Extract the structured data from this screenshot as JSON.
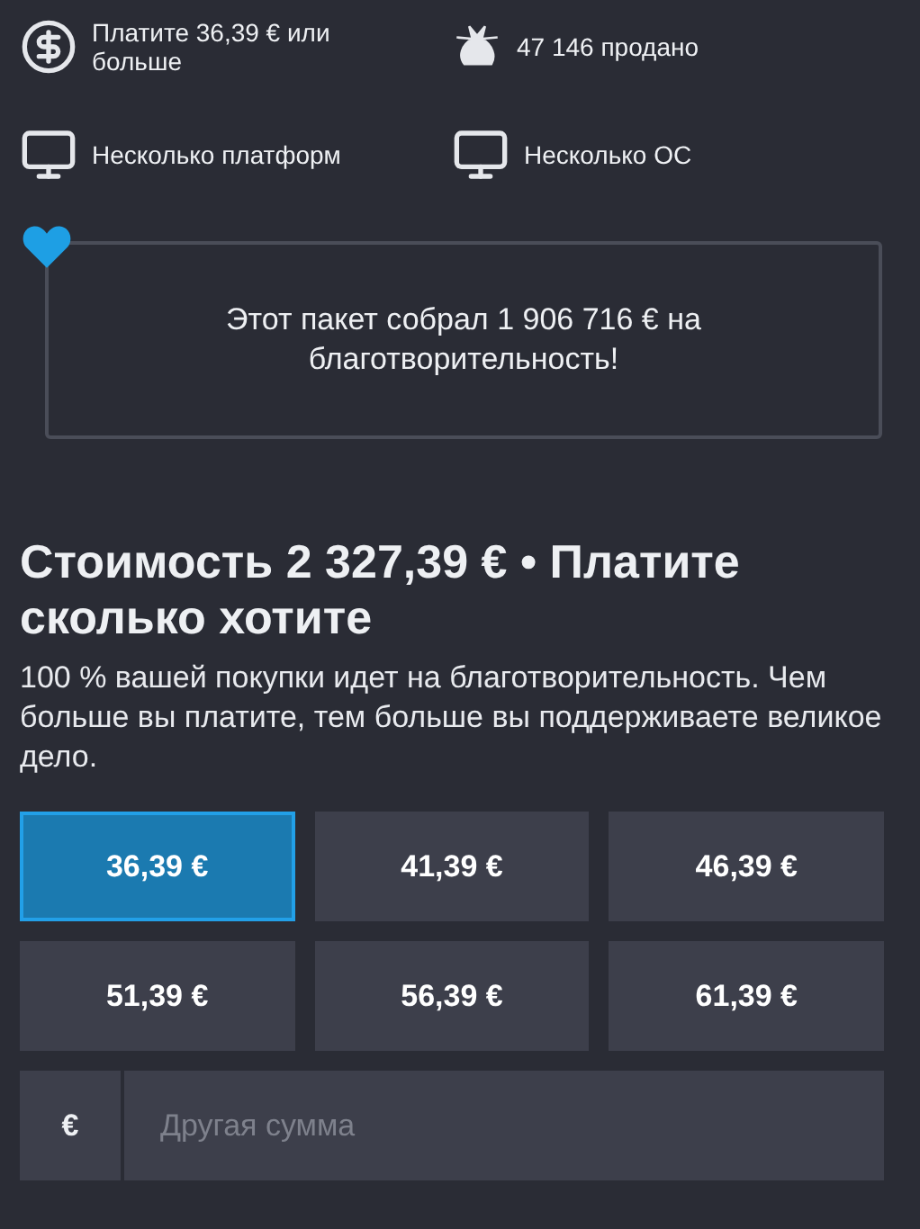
{
  "features": [
    {
      "kind": "price",
      "text": "Платите 36,39 € или больше"
    },
    {
      "kind": "sold",
      "text": "47 146 продано"
    },
    {
      "kind": "platform",
      "text": "Несколько платформ"
    },
    {
      "kind": "platform",
      "text": "Несколько ОС"
    }
  ],
  "charity": {
    "text": "Этот пакет собрал 1 906 716 € на благотворительность!"
  },
  "heading": "Стоимость 2 327,39 € • Платите сколько хотите",
  "description": "100 % вашей покупки идет на благотворительность. Чем больше вы платите, тем больше вы поддерживаете великое дело.",
  "amounts": [
    {
      "label": "36,39 €",
      "selected": true
    },
    {
      "label": "41,39 €",
      "selected": false
    },
    {
      "label": "46,39 €",
      "selected": false
    },
    {
      "label": "51,39 €",
      "selected": false
    },
    {
      "label": "56,39 €",
      "selected": false
    },
    {
      "label": "61,39 €",
      "selected": false
    }
  ],
  "custom": {
    "currency": "€",
    "placeholder": "Другая сумма"
  }
}
